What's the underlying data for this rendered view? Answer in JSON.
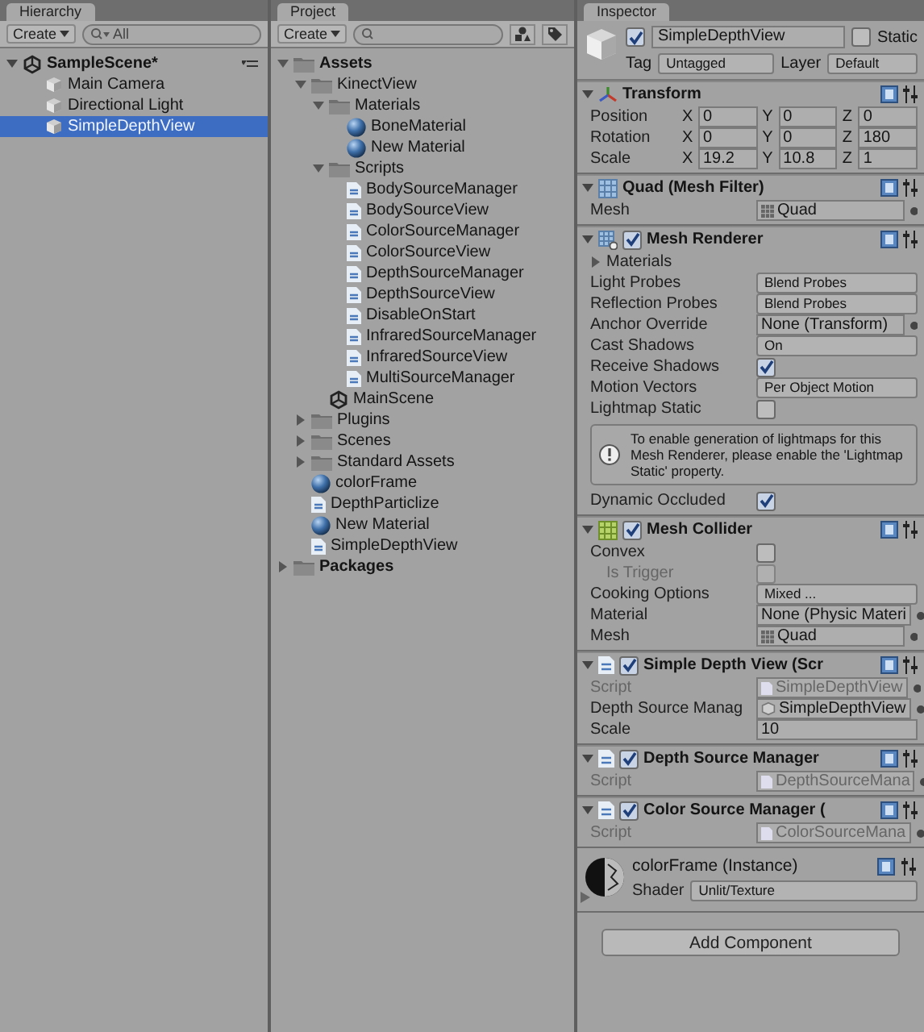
{
  "hierarchy": {
    "tab": "Hierarchy",
    "create": "Create",
    "search": {
      "placeholder": "All"
    },
    "items": [
      {
        "label": "SampleScene*",
        "kind": "scene",
        "expanded": true,
        "selected": false,
        "children": [
          {
            "label": "Main Camera",
            "kind": "gameobject",
            "selected": false
          },
          {
            "label": "Directional Light",
            "kind": "gameobject",
            "selected": false
          },
          {
            "label": "SimpleDepthView",
            "kind": "gameobject",
            "selected": true
          }
        ]
      }
    ]
  },
  "project": {
    "tab": "Project",
    "create": "Create",
    "items": [
      {
        "label": "Assets",
        "kind": "folder",
        "expanded": true,
        "children": [
          {
            "label": "KinectView",
            "kind": "folder",
            "expanded": true,
            "children": [
              {
                "label": "Materials",
                "kind": "folder",
                "expanded": true,
                "children": [
                  {
                    "label": "BoneMaterial",
                    "kind": "material"
                  },
                  {
                    "label": "New Material",
                    "kind": "material"
                  }
                ]
              },
              {
                "label": "Scripts",
                "kind": "folder",
                "expanded": true,
                "children": [
                  {
                    "label": "BodySourceManager",
                    "kind": "script"
                  },
                  {
                    "label": "BodySourceView",
                    "kind": "script"
                  },
                  {
                    "label": "ColorSourceManager",
                    "kind": "script"
                  },
                  {
                    "label": "ColorSourceView",
                    "kind": "script"
                  },
                  {
                    "label": "DepthSourceManager",
                    "kind": "script"
                  },
                  {
                    "label": "DepthSourceView",
                    "kind": "script"
                  },
                  {
                    "label": "DisableOnStart",
                    "kind": "script"
                  },
                  {
                    "label": "InfraredSourceManager",
                    "kind": "script"
                  },
                  {
                    "label": "InfraredSourceView",
                    "kind": "script"
                  },
                  {
                    "label": "MultiSourceManager",
                    "kind": "script"
                  }
                ]
              },
              {
                "label": "MainScene",
                "kind": "scene"
              }
            ]
          },
          {
            "label": "Plugins",
            "kind": "folder",
            "expanded": false
          },
          {
            "label": "Scenes",
            "kind": "folder",
            "expanded": false
          },
          {
            "label": "Standard Assets",
            "kind": "folder",
            "expanded": false
          },
          {
            "label": "colorFrame",
            "kind": "material"
          },
          {
            "label": "DepthParticlize",
            "kind": "script"
          },
          {
            "label": "New Material",
            "kind": "material"
          },
          {
            "label": "SimpleDepthView",
            "kind": "script"
          }
        ]
      },
      {
        "label": "Packages",
        "kind": "folder",
        "expanded": false
      }
    ]
  },
  "inspector": {
    "tab": "Inspector",
    "active": true,
    "name": "SimpleDepthView",
    "static": false,
    "static_label": "Static",
    "tag_label": "Tag",
    "tag": "Untagged",
    "layer_label": "Layer",
    "layer": "Default",
    "components": [
      {
        "title": "Transform",
        "kind": "transform",
        "expanded": true,
        "rows": [
          {
            "kind": "vector3",
            "label": "Position",
            "values": [
              {
                "axis": "X",
                "value": "0"
              },
              {
                "axis": "Y",
                "value": "0"
              },
              {
                "axis": "Z",
                "value": "0"
              }
            ]
          },
          {
            "kind": "vector3",
            "label": "Rotation",
            "values": [
              {
                "axis": "X",
                "value": "0"
              },
              {
                "axis": "Y",
                "value": "0"
              },
              {
                "axis": "Z",
                "value": "180"
              }
            ]
          },
          {
            "kind": "vector3",
            "label": "Scale",
            "values": [
              {
                "axis": "X",
                "value": "19.2"
              },
              {
                "axis": "Y",
                "value": "10.8"
              },
              {
                "axis": "Z",
                "value": "1"
              }
            ]
          }
        ]
      },
      {
        "title": "Quad (Mesh Filter)",
        "kind": "mesh",
        "expanded": true,
        "rows": [
          {
            "kind": "mesh_object",
            "label": "Mesh",
            "value": "Quad"
          }
        ]
      },
      {
        "title": "Mesh Renderer",
        "kind": "renderer",
        "enabled": true,
        "expanded": true,
        "rows": [
          {
            "kind": "foldout",
            "label": "Materials",
            "expanded": false
          },
          {
            "kind": "dropdown",
            "label": "Light Probes",
            "value": "Blend Probes"
          },
          {
            "kind": "dropdown",
            "label": "Reflection Probes",
            "value": "Blend Probes"
          },
          {
            "kind": "object",
            "label": "Anchor Override",
            "value": "None (Transform)"
          },
          {
            "kind": "dropdown",
            "label": "Cast Shadows",
            "value": "On"
          },
          {
            "kind": "checkbox",
            "label": "Receive Shadows",
            "checked": true
          },
          {
            "kind": "dropdown",
            "label": "Motion Vectors",
            "value": "Per Object Motion"
          },
          {
            "kind": "checkbox",
            "label": "Lightmap Static",
            "checked": false
          },
          {
            "kind": "help",
            "text": "To enable generation of lightmaps for this Mesh Renderer, please enable the 'Lightmap Static' property."
          },
          {
            "kind": "checkbox",
            "label": "Dynamic Occluded",
            "checked": true
          }
        ]
      },
      {
        "title": "Mesh Collider",
        "kind": "collider",
        "enabled": true,
        "expanded": true,
        "rows": [
          {
            "kind": "checkbox",
            "label": "Convex",
            "checked": false
          },
          {
            "kind": "checkbox",
            "label": "Is Trigger",
            "checked": false,
            "disabled": true
          },
          {
            "kind": "dropdown",
            "label": "Cooking Options",
            "value": "Mixed ..."
          },
          {
            "kind": "object",
            "label": "Material",
            "value": "None (Physic Materi"
          },
          {
            "kind": "mesh_object",
            "label": "Mesh",
            "value": "Quad"
          }
        ]
      },
      {
        "title": "Simple Depth View (Scr",
        "kind": "script",
        "enabled": true,
        "expanded": true,
        "rows": [
          {
            "kind": "script_object",
            "label": "Script",
            "value": "SimpleDepthView",
            "disabled": true
          },
          {
            "kind": "gameobject_object",
            "label": "Depth Source Manag",
            "value": "SimpleDepthView"
          },
          {
            "kind": "text",
            "label": "Scale",
            "value": "10"
          }
        ]
      },
      {
        "title": "Depth Source Manager",
        "kind": "script",
        "enabled": true,
        "expanded": true,
        "rows": [
          {
            "kind": "script_object",
            "label": "Script",
            "value": "DepthSourceMana",
            "disabled": true
          }
        ]
      },
      {
        "title": "Color Source Manager (",
        "kind": "script",
        "enabled": true,
        "expanded": true,
        "rows": [
          {
            "kind": "script_object",
            "label": "Script",
            "value": "ColorSourceMana",
            "disabled": true
          }
        ]
      }
    ],
    "material": {
      "name": "colorFrame (Instance)",
      "shader_label": "Shader",
      "shader": "Unlit/Texture",
      "expanded": false
    },
    "add_button": "Add Component"
  }
}
